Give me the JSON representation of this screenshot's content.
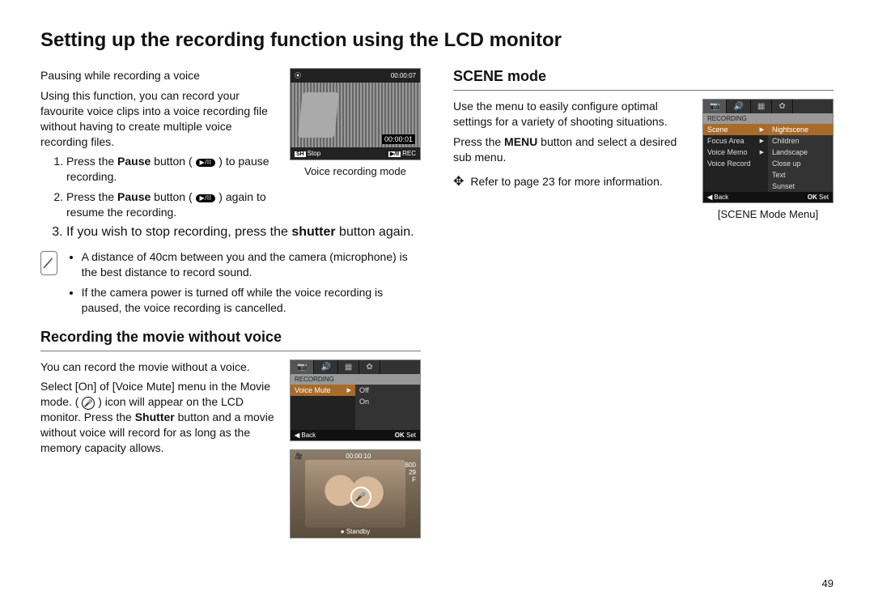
{
  "page_title": "Setting up the recording function using the LCD monitor",
  "page_number": "49",
  "left": {
    "pause": {
      "heading": "Pausing while recording a voice",
      "intro": "Using this function, you can record your favourite voice clips into a voice recording file without having to create multiple voice recording files.",
      "step1_a": "Press the ",
      "step1_b": "Pause",
      "step1_c": " button ( ",
      "step1_d": " ) to pause recording.",
      "step2_a": "Press the ",
      "step2_b": "Pause",
      "step2_c": " button ( ",
      "step2_d": " ) again to resume the recording.",
      "step3_a": "If you wish to stop recording, press the ",
      "step3_b": "shutter",
      "step3_c": " button again.",
      "lcd": {
        "top_right": "00:00:07",
        "timer": "00:00:01",
        "footer_left_key": "SH",
        "footer_left_text": "Stop",
        "footer_right_key": "▶/II",
        "footer_right_text": "REC",
        "caption": "Voice recording mode"
      }
    },
    "note": {
      "item1": "A distance of 40cm between you and the camera (microphone) is the best distance to record sound.",
      "item2": "If the camera power is turned off while the voice recording is paused, the voice recording is cancelled."
    },
    "movie": {
      "title": "Recording the movie without voice",
      "p1": "You can record the movie without a voice.",
      "p2_a": "Select [On] of [Voice Mute] menu in the Movie mode. ( ",
      "p2_b": " ) icon will appear on the LCD monitor. Press the ",
      "p2_c": "Shutter",
      "p2_d": " button and a movie without voice will record for as long as the memory capacity allows.",
      "lcd_menu": {
        "tab_icons": [
          "📷",
          "🔊",
          "▦",
          "✿"
        ],
        "title": "RECORDING",
        "left_item": "Voice Mute",
        "right_items": [
          "Off",
          "On"
        ],
        "footer_back": "Back",
        "footer_set": "Set",
        "footer_back_icon": "◀",
        "footer_set_icon": "OK"
      },
      "lcd_preview": {
        "top_center": "00:00:10",
        "right1": "800",
        "right2": "29",
        "right3": "F",
        "footer": "● Standby"
      }
    }
  },
  "right": {
    "scene": {
      "title": "SCENE mode",
      "p1": "Use the menu to easily configure optimal settings for a variety of shooting situations.",
      "p2_a": "Press the ",
      "p2_b": "MENU",
      "p2_c": " button and select a desired sub menu.",
      "ref": "Refer to page 23 for more information.",
      "lcd": {
        "tab_icons": [
          "📷",
          "🔊",
          "▦",
          "✿"
        ],
        "title": "RECORDING",
        "left_items": [
          "Scene",
          "Focus Area",
          "Voice Memo",
          "Voice Record"
        ],
        "right_items": [
          "Nightscene",
          "Children",
          "Landscape",
          "Close up",
          "Text",
          "Sunset"
        ],
        "footer_back": "Back",
        "footer_set": "Set",
        "footer_back_icon": "◀",
        "footer_set_icon": "OK",
        "caption": "[SCENE Mode Menu]"
      }
    }
  }
}
